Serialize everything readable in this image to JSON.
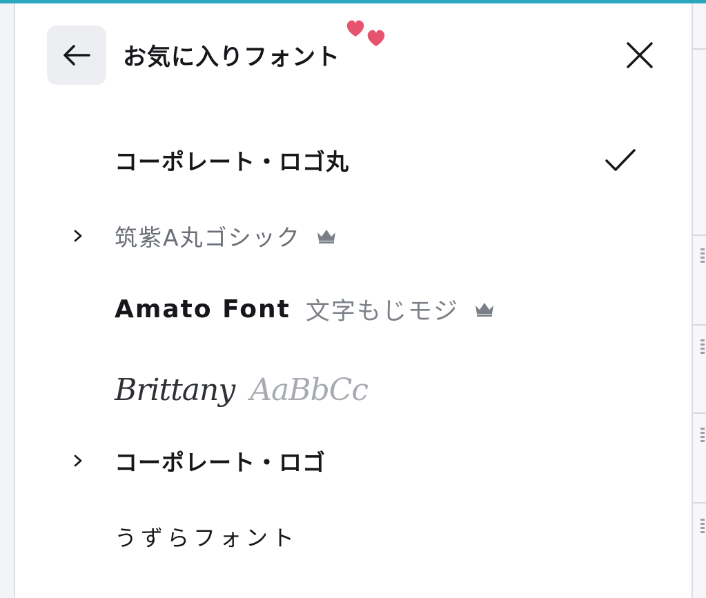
{
  "header": {
    "title": "お気に入りフォント",
    "back_icon": "arrow-left-icon",
    "close_icon": "close-icon",
    "decor_icon": "hearts-icon"
  },
  "fonts": [
    {
      "label": "コーポレート・ロゴ丸",
      "selected": true,
      "has_children": false,
      "premium": false
    },
    {
      "label": "筑紫A丸ゴシック",
      "selected": false,
      "has_children": true,
      "premium": true
    },
    {
      "label": "Amato Font",
      "sample": "文字もじモジ",
      "selected": false,
      "has_children": false,
      "premium": true
    },
    {
      "label": "Brittany",
      "sample": "AaBbCc",
      "selected": false,
      "has_children": false,
      "premium": false
    },
    {
      "label": "コーポレート・ロゴ",
      "selected": false,
      "has_children": true,
      "premium": false
    },
    {
      "label": "うずらフォント",
      "selected": false,
      "has_children": false,
      "premium": false
    }
  ],
  "colors": {
    "accent_top_line": "#2aa7bf",
    "heart": "#e5536f",
    "text_primary": "#15171a",
    "text_muted": "#6a6f76",
    "crown": "#7b8088"
  }
}
